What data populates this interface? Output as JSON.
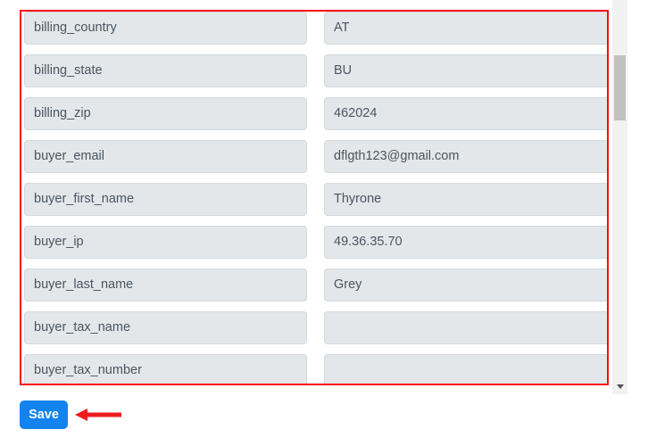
{
  "form": {
    "columns": [
      "key",
      "value"
    ],
    "rows": [
      {
        "key": "billing_country",
        "value": "AT"
      },
      {
        "key": "billing_state",
        "value": "BU"
      },
      {
        "key": "billing_zip",
        "value": "462024"
      },
      {
        "key": "buyer_email",
        "value": "dflgth123@gmail.com"
      },
      {
        "key": "buyer_first_name",
        "value": "Thyrone"
      },
      {
        "key": "buyer_ip",
        "value": "49.36.35.70"
      },
      {
        "key": "buyer_last_name",
        "value": "Grey"
      },
      {
        "key": "buyer_tax_name",
        "value": ""
      },
      {
        "key": "buyer_tax_number",
        "value": ""
      }
    ]
  },
  "actions": {
    "save_label": "Save"
  },
  "scrollbar": {
    "down_arrow_icon": "chevron-down-icon"
  },
  "annotation": {
    "arrow_icon": "left-arrow-icon",
    "highlight_color": "#fb0b0b",
    "arrow_color": "#ee1c1c"
  },
  "colors": {
    "field_background": "#e4e7ea",
    "field_border": "#d4d9dd",
    "field_text": "#4a5560",
    "save_button_background": "#1283ef",
    "save_button_text": "#ffffff",
    "highlight_border": "#fb0b0b",
    "scrollbar_track": "#f1f1f1",
    "scrollbar_thumb": "#c1c1c1",
    "page_background": "#ffffff"
  }
}
